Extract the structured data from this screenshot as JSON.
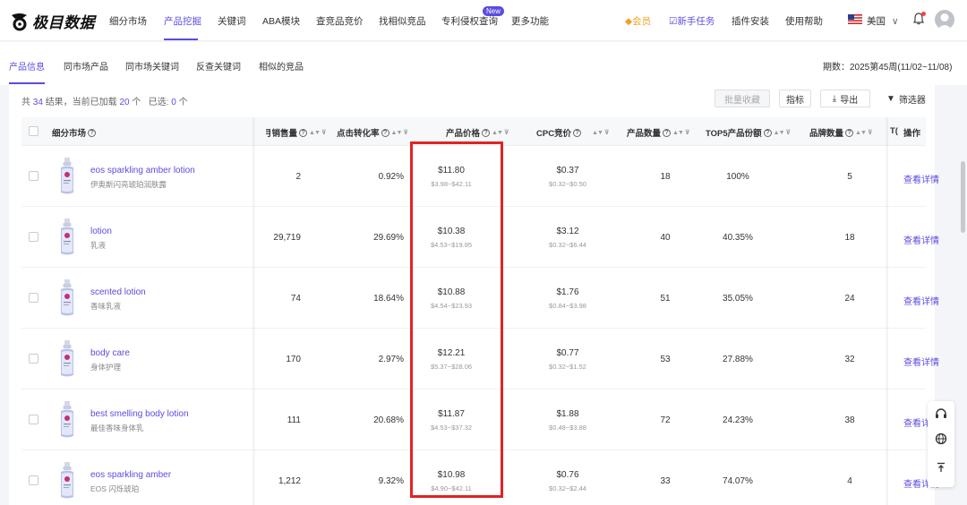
{
  "logo": {
    "text": "极目数据"
  },
  "nav": {
    "items": [
      "细分市场",
      "产品挖掘",
      "关键词",
      "ABA模块",
      "查竞品竞价",
      "找相似竞品",
      "专利侵权查询",
      "更多功能"
    ],
    "new_badge": "New",
    "vip": "◆会员",
    "task": "☑新手任务",
    "plugin": "插件安装",
    "help": "使用帮助",
    "region": "美国",
    "accent_color": "#5b4ce0"
  },
  "subtabs": {
    "items": [
      "产品信息",
      "同市场产品",
      "同市场关键词",
      "反查关键词",
      "相似的竞品"
    ],
    "period": "期数：2025第45周(11/02~11/08)"
  },
  "toolbar": {
    "summary_prefix": "共",
    "total": "34",
    "summary_mid": "结果，当前已加载",
    "loaded": "20",
    "summary_unit": "个",
    "selected_label": "已选:",
    "selected": "0",
    "selected_unit": "个",
    "batch_collect": "批量收藏",
    "metrics": "指标",
    "export": "导出",
    "filter": "筛选器"
  },
  "table": {
    "headers": {
      "market": "细分市场",
      "sales": "月销售量",
      "ctr": "点击转化率",
      "price": "产品价格",
      "cpc": "CPC竞价",
      "count": "产品数量",
      "top5": "TOP5产品份额",
      "brands": "品牌数量",
      "cut": "T(",
      "action": "操作"
    },
    "detail_label": "查看详情",
    "rows": [
      {
        "kw": "eos sparkling amber lotion",
        "kw_cn": "伊奥斯闪亮琥珀润肤露",
        "sales": "2",
        "ctr": "0.92%",
        "price": "$11.80",
        "price_range": "$3.98~$42.11",
        "cpc": "$0.37",
        "cpc_range": "$0.32~$0.50",
        "count": "18",
        "top5": "100%",
        "brands": "5"
      },
      {
        "kw": "lotion",
        "kw_cn": "乳液",
        "sales": "29,719",
        "ctr": "29.69%",
        "price": "$10.38",
        "price_range": "$4.53~$19.85",
        "cpc": "$3.12",
        "cpc_range": "$0.32~$6.44",
        "count": "40",
        "top5": "40.35%",
        "brands": "18"
      },
      {
        "kw": "scented lotion",
        "kw_cn": "香味乳液",
        "sales": "74",
        "ctr": "18.64%",
        "price": "$10.88",
        "price_range": "$4.54~$23.93",
        "cpc": "$1.76",
        "cpc_range": "$0.84~$3.98",
        "count": "51",
        "top5": "35.05%",
        "brands": "24"
      },
      {
        "kw": "body care",
        "kw_cn": "身体护理",
        "sales": "170",
        "ctr": "2.97%",
        "price": "$12.21",
        "price_range": "$5.37~$28.06",
        "cpc": "$0.77",
        "cpc_range": "$0.32~$1.52",
        "count": "53",
        "top5": "27.88%",
        "brands": "32"
      },
      {
        "kw": "best smelling body lotion",
        "kw_cn": "最佳香味身体乳",
        "sales": "111",
        "ctr": "20.68%",
        "price": "$11.87",
        "price_range": "$4.53~$37.32",
        "cpc": "$1.88",
        "cpc_range": "$0.48~$3.88",
        "count": "72",
        "top5": "24.23%",
        "brands": "38"
      },
      {
        "kw": "eos sparkling amber",
        "kw_cn": "EOS 闪烁琥珀",
        "sales": "1,212",
        "ctr": "9.32%",
        "price": "$10.98",
        "price_range": "$4.90~$42.11",
        "cpc": "$0.76",
        "cpc_range": "$0.32~$2.44",
        "count": "33",
        "top5": "74.07%",
        "brands": "4"
      }
    ]
  },
  "highlight_color": "#e02424"
}
